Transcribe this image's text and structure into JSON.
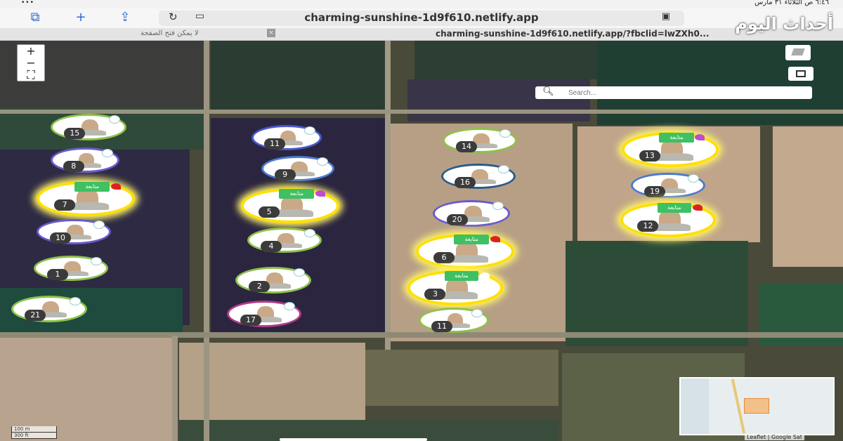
{
  "status_bar": {
    "time": "٦:٤٦ ص  الثلاثاء ٣١ مارس",
    "signal": "•••"
  },
  "browser": {
    "url": "charming-sunshine-1d9f610.netlify.app",
    "tab_inactive": "لا يمكن فتح الصفحة",
    "tab_active": "charming-sunshine-1d9f610.netlify.app/?fbclid=lwZXh0..."
  },
  "logo": "أحداث اليوم",
  "map": {
    "zoom_in": "+",
    "zoom_out": "−",
    "fullscreen": "⛶",
    "search_placeholder": "Search...",
    "scale_m": "100 m",
    "scale_ft": "300 ft",
    "attribution": "Leaflet | Google Sat",
    "markers": [
      {
        "num": "15",
        "gold": false,
        "ring": "#8dc24a"
      },
      {
        "num": "8",
        "gold": false,
        "ring": "#6a5acd"
      },
      {
        "num": "7",
        "gold": true,
        "ring": "#ffe000",
        "tag": "متابعة",
        "flag_color": "#e02020"
      },
      {
        "num": "10",
        "gold": false,
        "ring": "#6a5acd"
      },
      {
        "num": "1",
        "gold": false,
        "ring": "#8dc24a"
      },
      {
        "num": "21",
        "gold": false,
        "ring": "#8dc24a"
      },
      {
        "num": "11",
        "gold": false,
        "ring": "#4a5ad0"
      },
      {
        "num": "9",
        "gold": false,
        "ring": "#4a7ad0"
      },
      {
        "num": "5",
        "gold": true,
        "ring": "#ffe000",
        "tag": "متابعة",
        "flag_color": "#c04ad0"
      },
      {
        "num": "4",
        "gold": false,
        "ring": "#8dc24a"
      },
      {
        "num": "2",
        "gold": false,
        "ring": "#8dc24a"
      },
      {
        "num": "17",
        "gold": false,
        "ring": "#b03a8a"
      },
      {
        "num": "14",
        "gold": false,
        "ring": "#8dc24a"
      },
      {
        "num": "16",
        "gold": false,
        "ring": "#2a5a8a"
      },
      {
        "num": "20",
        "gold": false,
        "ring": "#6a5acd"
      },
      {
        "num": "6",
        "gold": true,
        "ring": "#ffe000",
        "tag": "متابعة",
        "flag_color": "#e02020"
      },
      {
        "num": "3",
        "gold": true,
        "ring": "#ffe000",
        "tag": "متابعة",
        "flag_color": "#ffffff"
      },
      {
        "num": "11",
        "gold": false,
        "ring": "#8dc24a"
      },
      {
        "num": "13",
        "gold": true,
        "ring": "#ffe000",
        "tag": "متابعة",
        "flag_color": "#c04ad0"
      },
      {
        "num": "19",
        "gold": false,
        "ring": "#4a7ad0"
      },
      {
        "num": "12",
        "gold": true,
        "ring": "#ffe000",
        "tag": "متابعة",
        "flag_color": "#e02020"
      }
    ]
  }
}
